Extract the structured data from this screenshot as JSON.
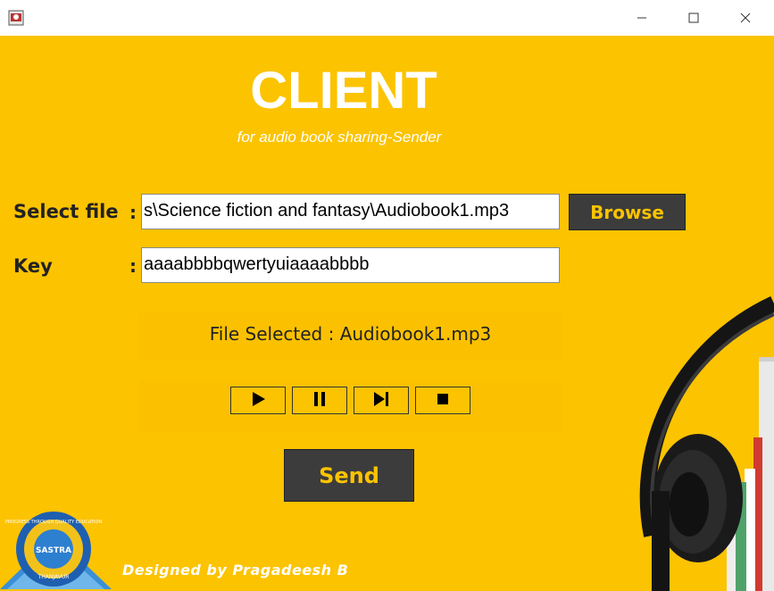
{
  "window": {
    "minimize_icon": "minimize-icon",
    "maximize_icon": "maximize-icon",
    "close_icon": "close-icon"
  },
  "header": {
    "title": "CLIENT",
    "subtitle": "for audio book sharing-Sender"
  },
  "form": {
    "file_label": "Select file",
    "file_colon": ":",
    "file_value": "s\\Science fiction and fantasy\\Audiobook1.mp3",
    "browse_label": "Browse",
    "key_label": "Key",
    "key_colon": ":",
    "key_value": "aaaabbbbqwertyuiaaaabbbb"
  },
  "status": {
    "file_selected": "File Selected : Audiobook1.mp3"
  },
  "player": {
    "controls": [
      "play-icon",
      "pause-icon",
      "skip-next-icon",
      "stop-icon"
    ]
  },
  "actions": {
    "send_label": "Send"
  },
  "footer": {
    "credit": "Designed by Pragadeesh B",
    "logo_text_top": "PROGRESS THROUGH QUALITY EDUCATION",
    "logo_text_center": "SASTRA",
    "logo_text_bottom": "THANJAVUR"
  },
  "colors": {
    "background": "#fcc300",
    "button_bg": "#3c3c3c",
    "button_text": "#fcc300"
  }
}
